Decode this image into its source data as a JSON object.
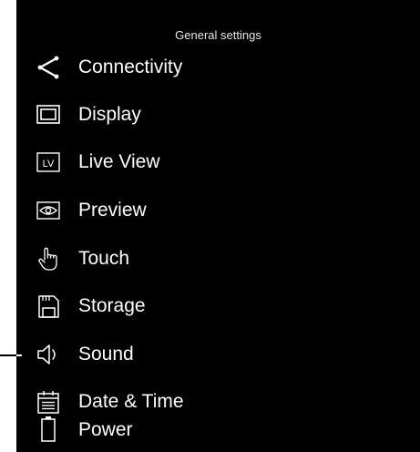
{
  "header": {
    "title": "General settings"
  },
  "menu": {
    "items": [
      {
        "label": "Connectivity",
        "icon": "share-icon"
      },
      {
        "label": "Display",
        "icon": "display-icon"
      },
      {
        "label": "Live View",
        "icon": "live-view-icon",
        "icon_text": "LV"
      },
      {
        "label": "Preview",
        "icon": "eye-icon"
      },
      {
        "label": "Touch",
        "icon": "hand-touch-icon"
      },
      {
        "label": "Storage",
        "icon": "sd-card-icon"
      },
      {
        "label": "Sound",
        "icon": "speaker-icon"
      },
      {
        "label": "Date & Time",
        "icon": "calendar-icon"
      },
      {
        "label": "Power",
        "icon": "battery-icon"
      }
    ]
  },
  "colors": {
    "background": "#000000",
    "text": "#ffffff",
    "title_text": "#e8e8e8",
    "callout_line": "#000000"
  }
}
